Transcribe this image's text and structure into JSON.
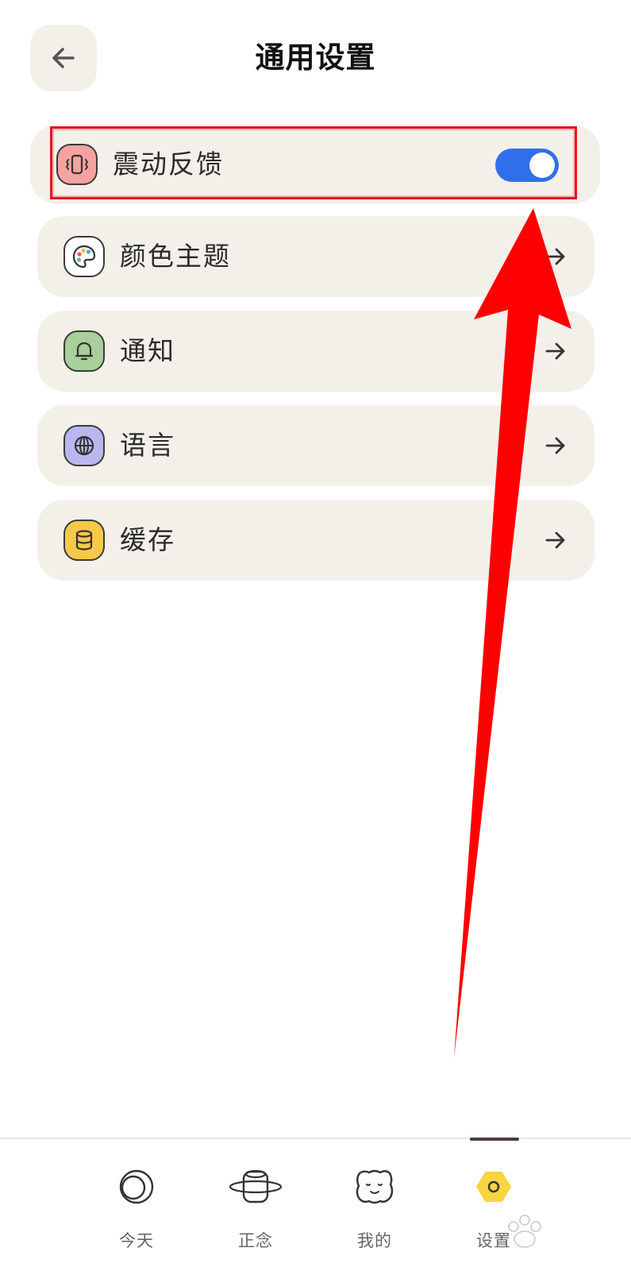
{
  "header": {
    "title": "通用设置",
    "back_icon": "arrow-left-icon"
  },
  "settings": {
    "haptic": {
      "label": "震动反馈",
      "icon": "vibrate-icon",
      "icon_bg": "#f4a3a0",
      "enabled": true
    },
    "items": [
      {
        "label": "颜色主题",
        "icon": "palette-icon",
        "icon_bg": "#ffffff"
      },
      {
        "label": "通知",
        "icon": "bell-icon",
        "icon_bg": "#a9cf9a"
      },
      {
        "label": "语言",
        "icon": "globe-icon",
        "icon_bg": "#b9b7f0"
      },
      {
        "label": "缓存",
        "icon": "database-icon",
        "icon_bg": "#f8c84a"
      }
    ]
  },
  "bottom_nav": {
    "items": [
      {
        "label": "今天",
        "icon": "moon-circle-icon"
      },
      {
        "label": "正念",
        "icon": "planet-icon"
      },
      {
        "label": "我的",
        "icon": "face-cloud-icon"
      },
      {
        "label": "设置",
        "icon": "hexagon-settings-icon",
        "active": true
      }
    ]
  },
  "colors": {
    "toggle_on": "#2f6fe9",
    "row_bg": "#f3f0ea",
    "annotation_red": "#ff0000",
    "nav_active_bar": "#4a3b36"
  }
}
